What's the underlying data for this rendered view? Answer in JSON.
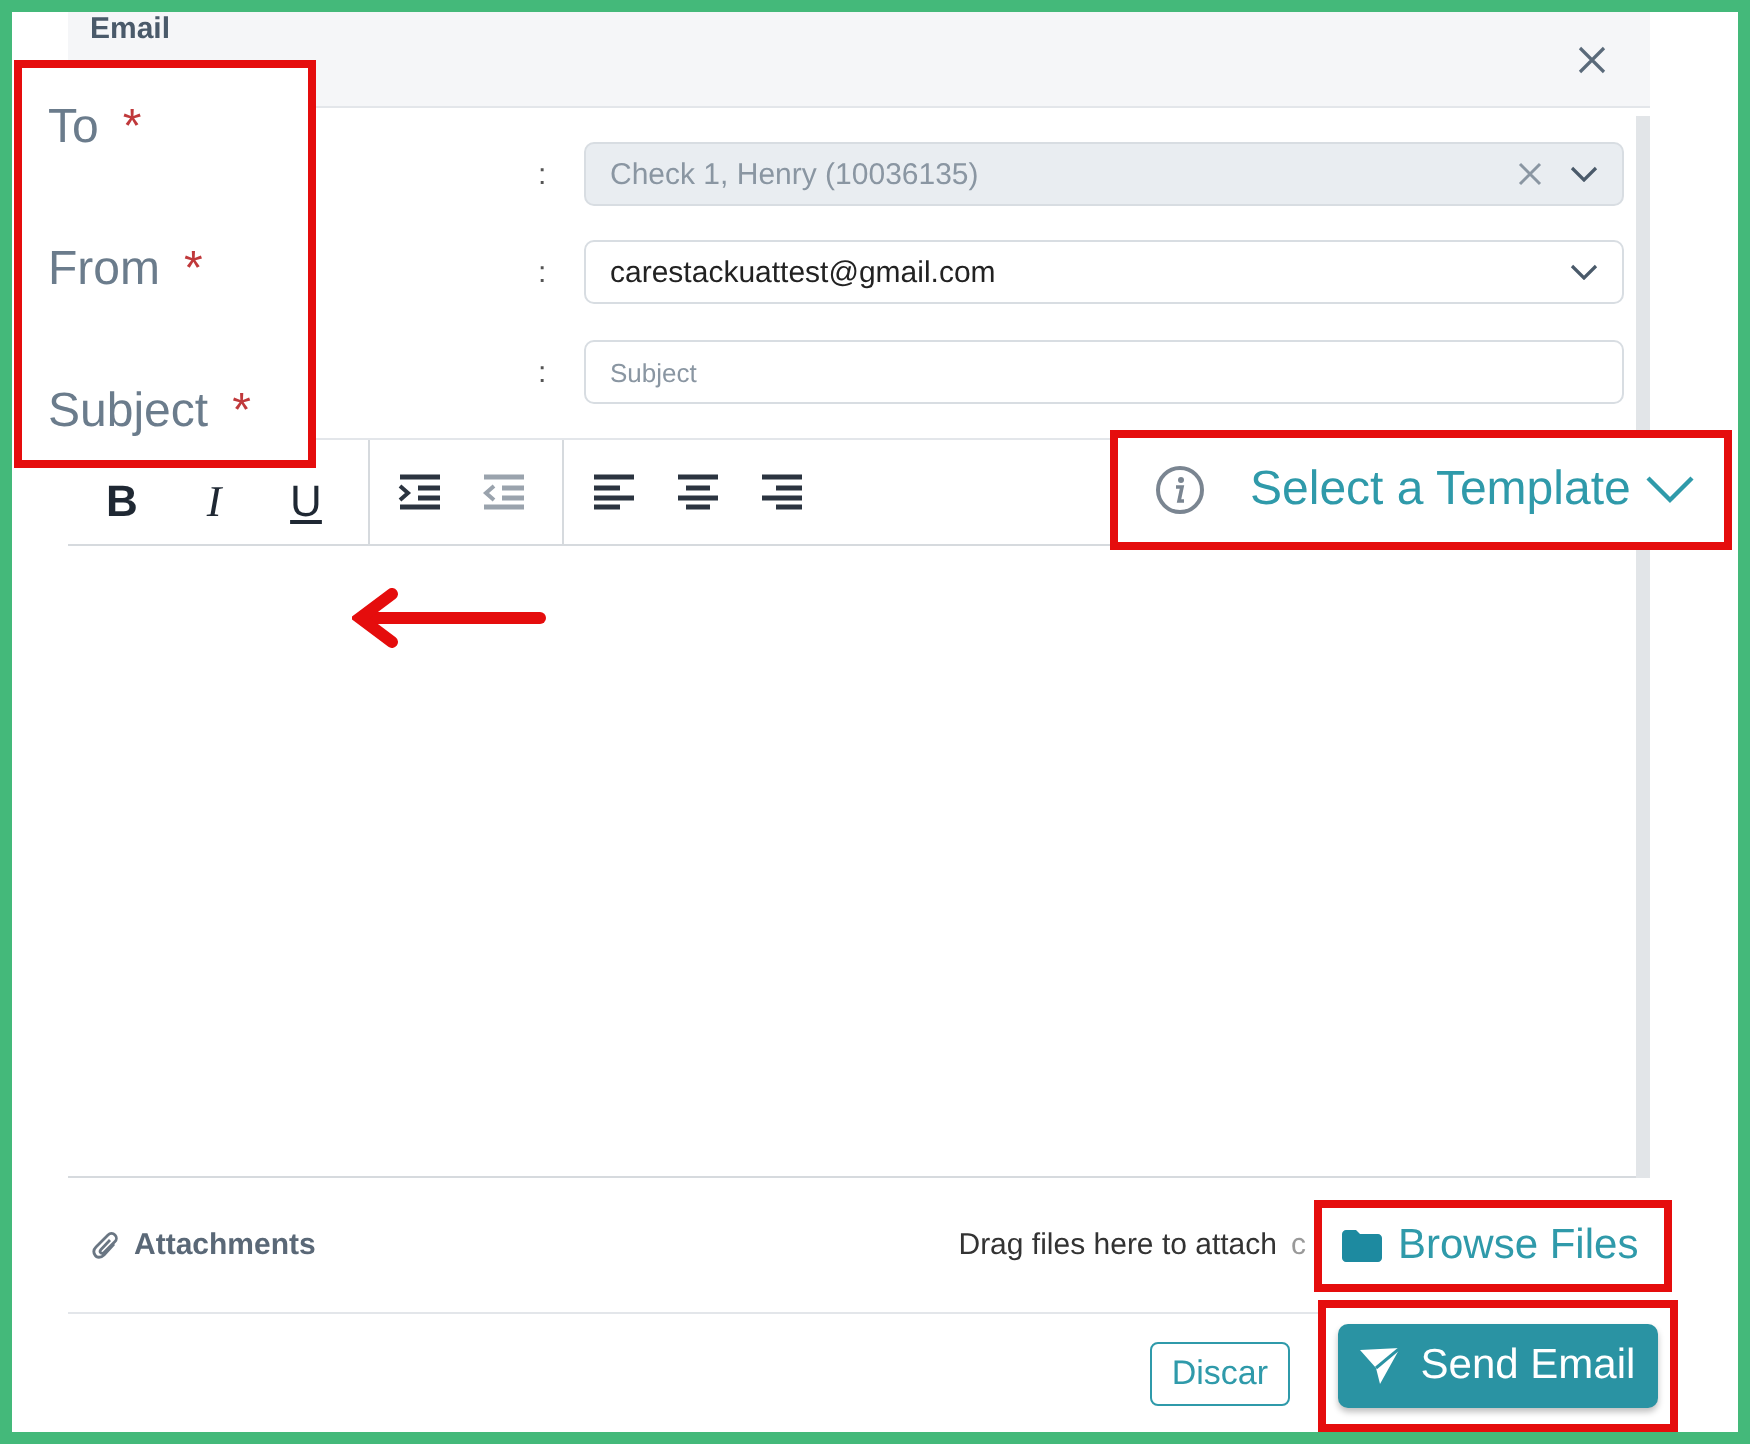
{
  "dialog": {
    "title": "Email"
  },
  "fields": [
    {
      "kind": "select",
      "colon": ":",
      "value": "Check 1, Henry (10036135)",
      "disabled": true,
      "clearable": true
    },
    {
      "kind": "select",
      "colon": ":",
      "value": "carestackuattest@gmail.com",
      "disabled": false,
      "clearable": false
    },
    {
      "kind": "text",
      "colon": ":",
      "placeholder": "Subject",
      "disabled": false
    }
  ],
  "toolbar": [
    [
      {
        "kind": "bold",
        "label": "B",
        "disabled": false
      },
      {
        "kind": "italic",
        "label": "I",
        "disabled": false
      },
      {
        "kind": "underline",
        "label": "U",
        "disabled": false
      }
    ],
    [
      {
        "kind": "indent",
        "disabled": false
      },
      {
        "kind": "outdent",
        "disabled": true
      }
    ],
    [
      {
        "kind": "align-left",
        "disabled": false
      },
      {
        "kind": "align-center",
        "disabled": false
      },
      {
        "kind": "align-right",
        "disabled": false
      }
    ]
  ],
  "attachments": {
    "label": "Attachments",
    "hint": "Drag files here to attach",
    "hint_tail": "c"
  },
  "footer": {
    "discard": "Discar"
  },
  "callouts": {
    "labels": [
      {
        "text": "To",
        "mark": "*"
      },
      {
        "text": "From",
        "mark": "*"
      },
      {
        "text": "Subject",
        "mark": "*"
      }
    ],
    "template": "Select a Template",
    "browse": "Browse Files",
    "send": "Send Email"
  }
}
